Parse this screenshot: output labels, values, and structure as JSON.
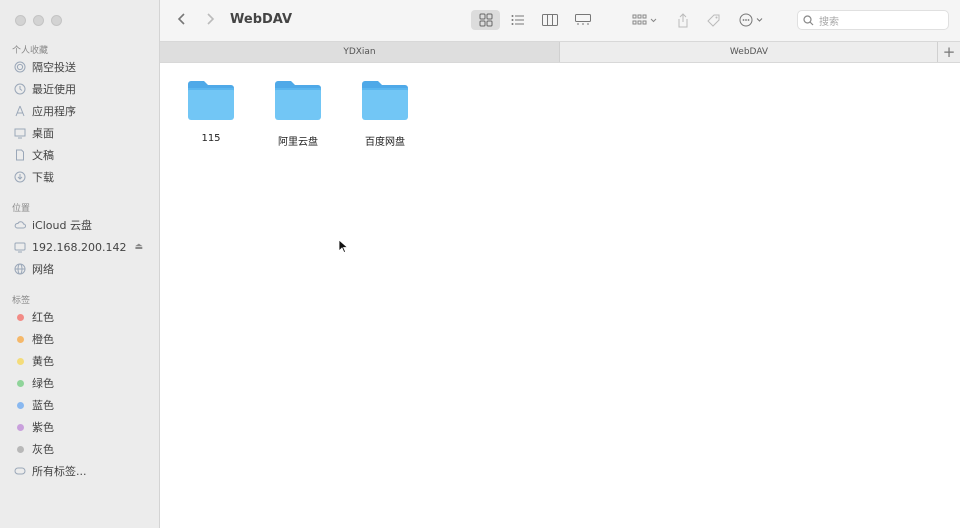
{
  "window": {
    "title": "WebDAV"
  },
  "sidebar": {
    "favorites_title": "个人收藏",
    "favorites": [
      {
        "label": "隔空投送",
        "icon": "airdrop-icon"
      },
      {
        "label": "最近使用",
        "icon": "clock-icon"
      },
      {
        "label": "应用程序",
        "icon": "applications-icon"
      },
      {
        "label": "桌面",
        "icon": "desktop-icon"
      },
      {
        "label": "文稿",
        "icon": "document-icon"
      },
      {
        "label": "下载",
        "icon": "download-icon"
      }
    ],
    "locations_title": "位置",
    "locations": [
      {
        "label": "iCloud 云盘",
        "icon": "cloud-icon"
      },
      {
        "label": "192.168.200.142",
        "icon": "display-icon"
      },
      {
        "label": "网络",
        "icon": "globe-icon"
      }
    ],
    "tags_title": "标签",
    "tags": [
      {
        "label": "红色",
        "color": "#f28b86"
      },
      {
        "label": "橙色",
        "color": "#f5b86a"
      },
      {
        "label": "黄色",
        "color": "#f4dc7a"
      },
      {
        "label": "绿色",
        "color": "#8fd49a"
      },
      {
        "label": "蓝色",
        "color": "#89b8f0"
      },
      {
        "label": "紫色",
        "color": "#c9a0dc"
      },
      {
        "label": "灰色",
        "color": "#b8b8b8"
      }
    ],
    "all_tags": "所有标签..."
  },
  "toolbar": {
    "search_placeholder": "搜索"
  },
  "tabs": [
    {
      "label": "YDXian",
      "active": false
    },
    {
      "label": "WebDAV",
      "active": true
    }
  ],
  "files": [
    {
      "name": "115"
    },
    {
      "name": "阿里云盘"
    },
    {
      "name": "百度网盘"
    }
  ],
  "colors": {
    "folder_body": "#72c6f5",
    "folder_tab": "#4fa9e8",
    "folder_edge": "#5ab6ef"
  }
}
